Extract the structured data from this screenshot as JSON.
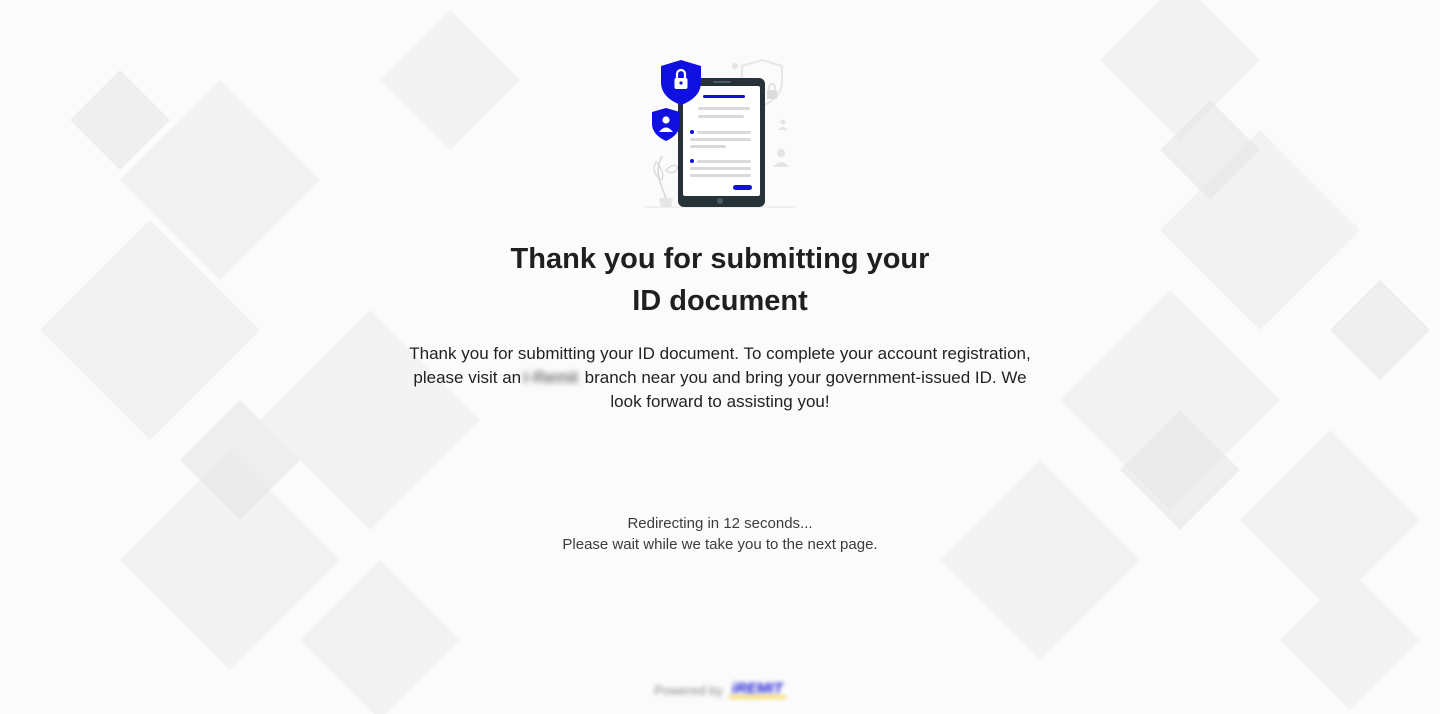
{
  "heading": {
    "line1": "Thank you for submitting your",
    "line2": "ID document"
  },
  "message": {
    "part1": "Thank you for submitting your ID document. To complete your account registration, please visit an",
    "redacted_brand": "I-Remit",
    "part2": " branch near you and bring your government-issued ID. We look forward to assisting you!"
  },
  "redirect": {
    "countdown": "Redirecting in 12 seconds...",
    "wait_note": "Please wait while we take you to the next page."
  },
  "footer": {
    "powered_by": "Powered by",
    "brand_logo": "iREMIT"
  },
  "colors": {
    "accent": "#1010e0",
    "device_dark": "#263238",
    "background": "#fbfbfb"
  },
  "icons": [
    "lock-shield-icon",
    "user-shield-icon",
    "phone-document-icon"
  ]
}
